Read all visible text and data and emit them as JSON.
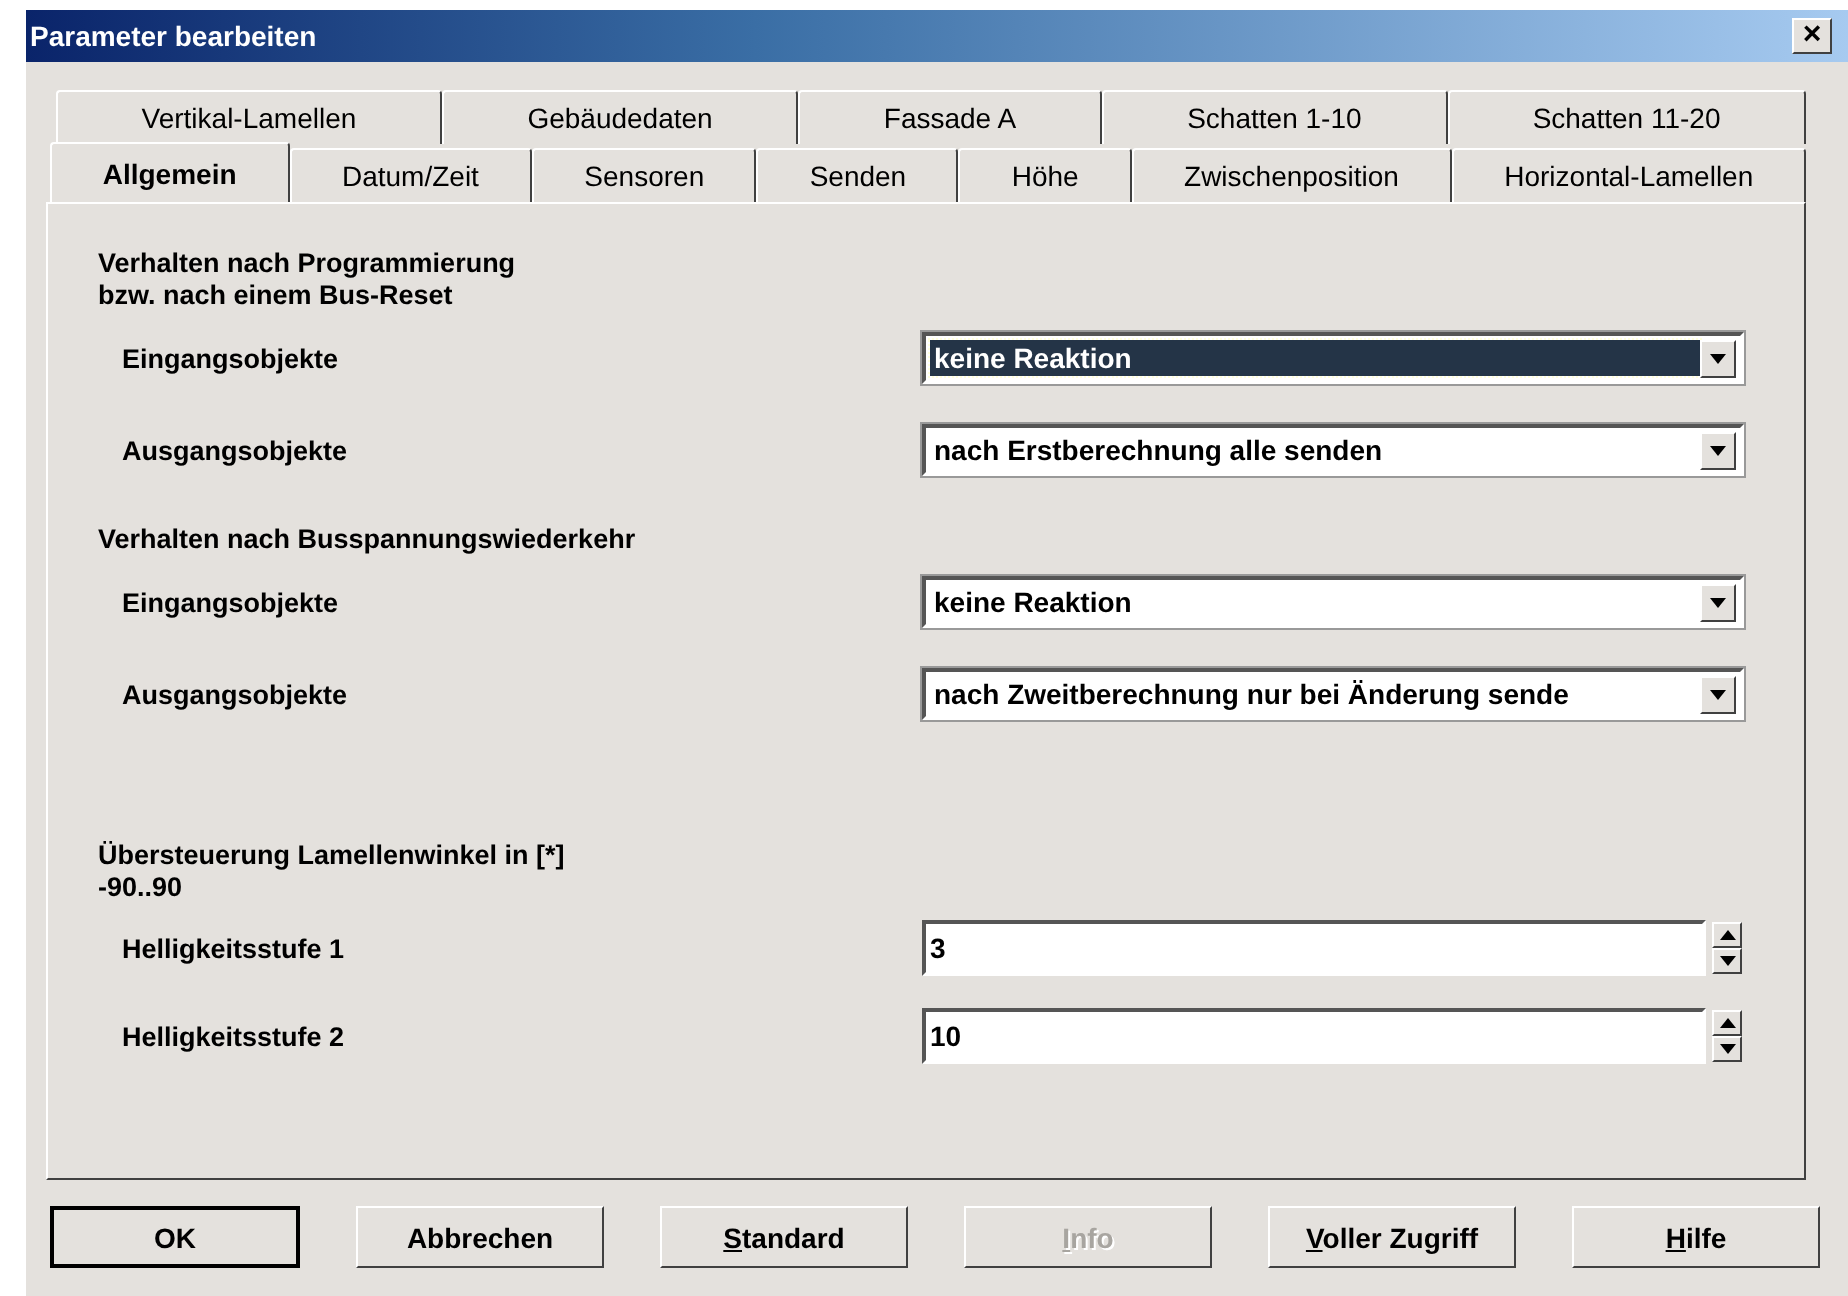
{
  "window": {
    "title": "Parameter bearbeiten",
    "close": "×"
  },
  "tab_rows": [
    [
      {
        "label": "Vertikal-Lamellen",
        "selected": false
      },
      {
        "label": "Gebäudedaten",
        "selected": false
      },
      {
        "label": "Fassade A",
        "selected": false
      },
      {
        "label": "Schatten 1-10",
        "selected": false
      },
      {
        "label": "Schatten 11-20",
        "selected": false
      }
    ],
    [
      {
        "label": "Allgemein",
        "selected": true
      },
      {
        "label": "Datum/Zeit",
        "selected": false
      },
      {
        "label": "Sensoren",
        "selected": false
      },
      {
        "label": "Senden",
        "selected": false
      },
      {
        "label": "Höhe",
        "selected": false
      },
      {
        "label": "Zwischenposition",
        "selected": false
      },
      {
        "label": "Horizontal-Lamellen",
        "selected": false
      }
    ]
  ],
  "rows": [
    {
      "kind": "heading",
      "lines": [
        "Verhalten nach Programmierung",
        "bzw. nach einem Bus-Reset"
      ]
    },
    {
      "kind": "select",
      "label": "Eingangsobjekte",
      "value": "keine Reaktion",
      "focused": true
    },
    {
      "kind": "select",
      "label": "Ausgangsobjekte",
      "value": "nach Erstberechnung alle senden",
      "focused": false
    },
    {
      "kind": "heading",
      "lines": [
        "Verhalten nach Busspannungswiederkehr"
      ]
    },
    {
      "kind": "select",
      "label": "Eingangsobjekte",
      "value": "keine Reaktion",
      "focused": false
    },
    {
      "kind": "select",
      "label": "Ausgangsobjekte",
      "value": "nach Zweitberechnung nur bei Änderung sende",
      "focused": false
    },
    {
      "kind": "heading",
      "lines": [
        "Übersteuerung Lamellenwinkel in [*]",
        "-90..90"
      ]
    },
    {
      "kind": "spin",
      "label": "Helligkeitsstufe 1",
      "value": "3"
    },
    {
      "kind": "spin",
      "label": "Helligkeitsstufe 2",
      "value": "10"
    }
  ],
  "buttons": [
    {
      "label": "OK",
      "default": true,
      "disabled": false,
      "underline_first": false
    },
    {
      "label": "Abbrechen",
      "default": false,
      "disabled": false,
      "underline_first": false
    },
    {
      "label": "Standard",
      "default": false,
      "disabled": false,
      "underline_first": true
    },
    {
      "label": "Info",
      "default": false,
      "disabled": true,
      "underline_first": true
    },
    {
      "label": "Voller Zugriff",
      "default": false,
      "disabled": false,
      "underline_first": true
    },
    {
      "label": "Hilfe",
      "default": false,
      "disabled": false,
      "underline_first": true
    }
  ]
}
